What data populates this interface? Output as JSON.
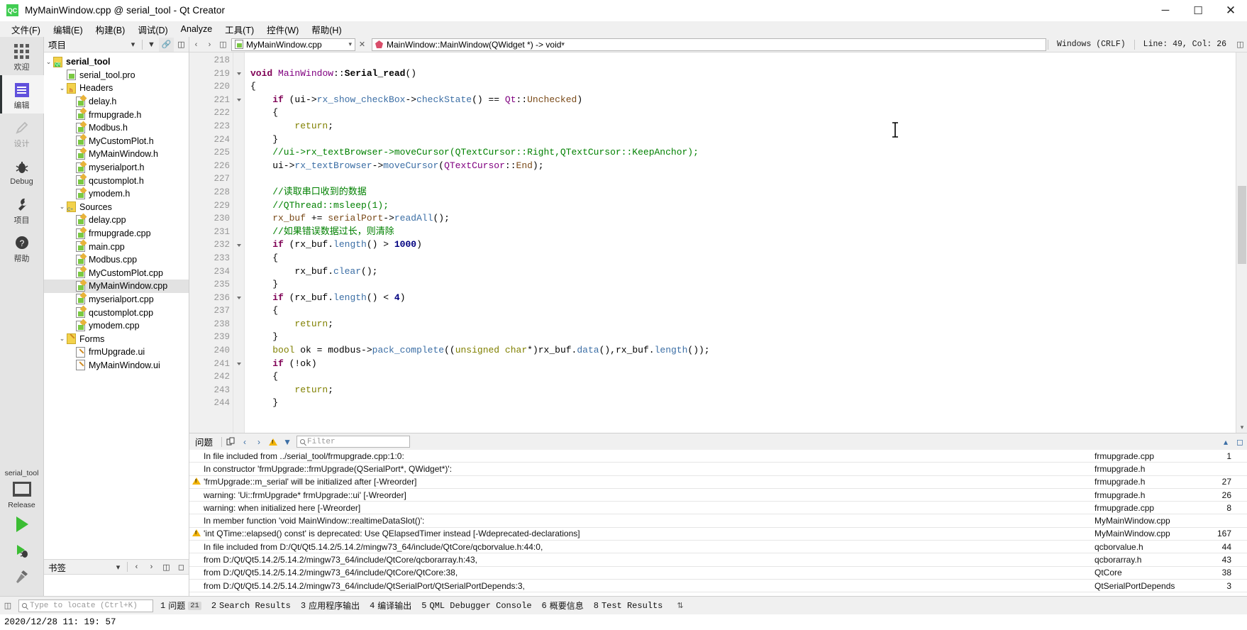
{
  "window": {
    "title": "MyMainWindow.cpp @ serial_tool - Qt Creator",
    "app_badge": "QC",
    "minimize": "─",
    "maximize": "☐",
    "close": "✕"
  },
  "menubar": [
    {
      "label": "文件(F)"
    },
    {
      "label": "编辑(E)"
    },
    {
      "label": "构建(B)"
    },
    {
      "label": "调试(D)"
    },
    {
      "label": "Analyze"
    },
    {
      "label": "工具(T)"
    },
    {
      "label": "控件(W)"
    },
    {
      "label": "帮助(H)"
    }
  ],
  "modebar": {
    "modes": [
      {
        "label": "欢迎",
        "icon": "grid-icon"
      },
      {
        "label": "编辑",
        "icon": "edit-icon"
      },
      {
        "label": "设计",
        "icon": "pencil-icon"
      },
      {
        "label": "Debug",
        "icon": "bug-icon"
      },
      {
        "label": "项目",
        "icon": "wrench-icon"
      },
      {
        "label": "帮助",
        "icon": "help-icon"
      }
    ],
    "kit_project": "serial_tool",
    "kit_build": "Release",
    "run_icon": "run-play-icon",
    "debug_icon": "debug-run-icon",
    "build_icon": "build-hammer-icon"
  },
  "sidepane": {
    "title": "项目",
    "bookmarks_title": "书签",
    "tree": [
      {
        "label": "serial_tool",
        "indent": 0,
        "icon": "qt-project-icon",
        "arrow": "⌄",
        "bold": true,
        "selected": false
      },
      {
        "label": "serial_tool.pro",
        "indent": 1,
        "icon": "pro-file-icon",
        "arrow": "",
        "bold": false,
        "selected": false
      },
      {
        "label": "Headers",
        "indent": 1,
        "icon": "headers-folder-icon",
        "arrow": "⌄",
        "bold": false,
        "selected": false
      },
      {
        "label": "delay.h",
        "indent": 2,
        "icon": "header-file-icon",
        "arrow": "",
        "bold": false,
        "selected": false
      },
      {
        "label": "frmupgrade.h",
        "indent": 2,
        "icon": "header-file-icon",
        "arrow": "",
        "bold": false,
        "selected": false
      },
      {
        "label": "Modbus.h",
        "indent": 2,
        "icon": "header-file-icon",
        "arrow": "",
        "bold": false,
        "selected": false
      },
      {
        "label": "MyCustomPlot.h",
        "indent": 2,
        "icon": "header-file-icon",
        "arrow": "",
        "bold": false,
        "selected": false
      },
      {
        "label": "MyMainWindow.h",
        "indent": 2,
        "icon": "header-file-icon",
        "arrow": "",
        "bold": false,
        "selected": false
      },
      {
        "label": "myserialport.h",
        "indent": 2,
        "icon": "header-file-icon",
        "arrow": "",
        "bold": false,
        "selected": false
      },
      {
        "label": "qcustomplot.h",
        "indent": 2,
        "icon": "header-file-icon",
        "arrow": "",
        "bold": false,
        "selected": false
      },
      {
        "label": "ymodem.h",
        "indent": 2,
        "icon": "header-file-icon",
        "arrow": "",
        "bold": false,
        "selected": false
      },
      {
        "label": "Sources",
        "indent": 1,
        "icon": "sources-folder-icon",
        "arrow": "⌄",
        "bold": false,
        "selected": false
      },
      {
        "label": "delay.cpp",
        "indent": 2,
        "icon": "cpp-file-icon",
        "arrow": "",
        "bold": false,
        "selected": false
      },
      {
        "label": "frmupgrade.cpp",
        "indent": 2,
        "icon": "cpp-file-icon",
        "arrow": "",
        "bold": false,
        "selected": false
      },
      {
        "label": "main.cpp",
        "indent": 2,
        "icon": "cpp-file-icon",
        "arrow": "",
        "bold": false,
        "selected": false
      },
      {
        "label": "Modbus.cpp",
        "indent": 2,
        "icon": "cpp-file-icon",
        "arrow": "",
        "bold": false,
        "selected": false
      },
      {
        "label": "MyCustomPlot.cpp",
        "indent": 2,
        "icon": "cpp-file-icon",
        "arrow": "",
        "bold": false,
        "selected": false
      },
      {
        "label": "MyMainWindow.cpp",
        "indent": 2,
        "icon": "cpp-file-icon",
        "arrow": "",
        "bold": false,
        "selected": true
      },
      {
        "label": "myserialport.cpp",
        "indent": 2,
        "icon": "cpp-file-icon",
        "arrow": "",
        "bold": false,
        "selected": false
      },
      {
        "label": "qcustomplot.cpp",
        "indent": 2,
        "icon": "cpp-file-icon",
        "arrow": "",
        "bold": false,
        "selected": false
      },
      {
        "label": "ymodem.cpp",
        "indent": 2,
        "icon": "cpp-file-icon",
        "arrow": "",
        "bold": false,
        "selected": false
      },
      {
        "label": "Forms",
        "indent": 1,
        "icon": "forms-folder-icon",
        "arrow": "⌄",
        "bold": false,
        "selected": false
      },
      {
        "label": "frmUpgrade.ui",
        "indent": 2,
        "icon": "ui-file-icon",
        "arrow": "",
        "bold": false,
        "selected": false
      },
      {
        "label": "MyMainWindow.ui",
        "indent": 2,
        "icon": "ui-file-icon",
        "arrow": "",
        "bold": false,
        "selected": false
      }
    ]
  },
  "editor": {
    "file_combo": "MyMainWindow.cpp",
    "symbol_combo": "MainWindow::MainWindow(QWidget *) -> void",
    "line_ending": "Windows (CRLF)",
    "cursor_position": "Line: 49, Col: 26",
    "first_line": 218,
    "lines": [
      {
        "n": 218,
        "fold": false,
        "tokens": []
      },
      {
        "n": 219,
        "fold": true,
        "tokens": [
          {
            "t": "void",
            "c": "k"
          },
          {
            "t": " ",
            "c": "plain"
          },
          {
            "t": "MainWindow",
            "c": "cls"
          },
          {
            "t": "::",
            "c": "plain"
          },
          {
            "t": "Serial_read",
            "c": "fn"
          },
          {
            "t": "()",
            "c": "plain"
          }
        ]
      },
      {
        "n": 220,
        "fold": false,
        "tokens": [
          {
            "t": "{",
            "c": "plain"
          }
        ]
      },
      {
        "n": 221,
        "fold": true,
        "tokens": [
          {
            "t": "    ",
            "c": "plain"
          },
          {
            "t": "if",
            "c": "k"
          },
          {
            "t": " (ui->",
            "c": "plain"
          },
          {
            "t": "rx_show_checkBox",
            "c": "call"
          },
          {
            "t": "->",
            "c": "plain"
          },
          {
            "t": "checkState",
            "c": "call"
          },
          {
            "t": "() == ",
            "c": "plain"
          },
          {
            "t": "Qt",
            "c": "cls"
          },
          {
            "t": "::",
            "c": "plain"
          },
          {
            "t": "Unchecked",
            "c": "var"
          },
          {
            "t": ")",
            "c": "plain"
          }
        ]
      },
      {
        "n": 222,
        "fold": false,
        "tokens": [
          {
            "t": "    {",
            "c": "plain"
          }
        ]
      },
      {
        "n": 223,
        "fold": false,
        "tokens": [
          {
            "t": "        ",
            "c": "plain"
          },
          {
            "t": "return",
            "c": "kw2"
          },
          {
            "t": ";",
            "c": "plain"
          }
        ]
      },
      {
        "n": 224,
        "fold": false,
        "tokens": [
          {
            "t": "    }",
            "c": "plain"
          }
        ]
      },
      {
        "n": 225,
        "fold": false,
        "tokens": [
          {
            "t": "    //ui->rx_textBrowser->moveCursor(QTextCursor::Right,QTextCursor::KeepAnchor);",
            "c": "cmt"
          }
        ]
      },
      {
        "n": 226,
        "fold": false,
        "tokens": [
          {
            "t": "    ui->",
            "c": "plain"
          },
          {
            "t": "rx_textBrowser",
            "c": "call"
          },
          {
            "t": "->",
            "c": "plain"
          },
          {
            "t": "moveCursor",
            "c": "call"
          },
          {
            "t": "(",
            "c": "plain"
          },
          {
            "t": "QTextCursor",
            "c": "cls"
          },
          {
            "t": "::",
            "c": "plain"
          },
          {
            "t": "End",
            "c": "var"
          },
          {
            "t": ");",
            "c": "plain"
          }
        ]
      },
      {
        "n": 227,
        "fold": false,
        "tokens": []
      },
      {
        "n": 228,
        "fold": false,
        "tokens": [
          {
            "t": "    //读取串口收到的数据",
            "c": "cmt"
          }
        ]
      },
      {
        "n": 229,
        "fold": false,
        "tokens": [
          {
            "t": "    //QThread::msleep(1);",
            "c": "cmt"
          }
        ]
      },
      {
        "n": 230,
        "fold": false,
        "tokens": [
          {
            "t": "    ",
            "c": "plain"
          },
          {
            "t": "rx_buf",
            "c": "var"
          },
          {
            "t": " += ",
            "c": "plain"
          },
          {
            "t": "serialPort",
            "c": "var"
          },
          {
            "t": "->",
            "c": "plain"
          },
          {
            "t": "readAll",
            "c": "call"
          },
          {
            "t": "();",
            "c": "plain"
          }
        ]
      },
      {
        "n": 231,
        "fold": false,
        "tokens": [
          {
            "t": "    //如果错误数据过长，则清除",
            "c": "cmt"
          }
        ]
      },
      {
        "n": 232,
        "fold": true,
        "tokens": [
          {
            "t": "    ",
            "c": "plain"
          },
          {
            "t": "if",
            "c": "k"
          },
          {
            "t": " (rx_buf.",
            "c": "plain"
          },
          {
            "t": "length",
            "c": "call"
          },
          {
            "t": "() > ",
            "c": "plain"
          },
          {
            "t": "1000",
            "c": "num"
          },
          {
            "t": ")",
            "c": "plain"
          }
        ]
      },
      {
        "n": 233,
        "fold": false,
        "tokens": [
          {
            "t": "    {",
            "c": "plain"
          }
        ]
      },
      {
        "n": 234,
        "fold": false,
        "tokens": [
          {
            "t": "        rx_buf.",
            "c": "plain"
          },
          {
            "t": "clear",
            "c": "call"
          },
          {
            "t": "();",
            "c": "plain"
          }
        ]
      },
      {
        "n": 235,
        "fold": false,
        "tokens": [
          {
            "t": "    }",
            "c": "plain"
          }
        ]
      },
      {
        "n": 236,
        "fold": true,
        "tokens": [
          {
            "t": "    ",
            "c": "plain"
          },
          {
            "t": "if",
            "c": "k"
          },
          {
            "t": " (rx_buf.",
            "c": "plain"
          },
          {
            "t": "length",
            "c": "call"
          },
          {
            "t": "() < ",
            "c": "plain"
          },
          {
            "t": "4",
            "c": "num"
          },
          {
            "t": ")",
            "c": "plain"
          }
        ]
      },
      {
        "n": 237,
        "fold": false,
        "tokens": [
          {
            "t": "    {",
            "c": "plain"
          }
        ]
      },
      {
        "n": 238,
        "fold": false,
        "tokens": [
          {
            "t": "        ",
            "c": "plain"
          },
          {
            "t": "return",
            "c": "kw2"
          },
          {
            "t": ";",
            "c": "plain"
          }
        ]
      },
      {
        "n": 239,
        "fold": false,
        "tokens": [
          {
            "t": "    }",
            "c": "plain"
          }
        ]
      },
      {
        "n": 240,
        "fold": false,
        "tokens": [
          {
            "t": "    ",
            "c": "plain"
          },
          {
            "t": "bool",
            "c": "kw2"
          },
          {
            "t": " ok = modbus->",
            "c": "plain"
          },
          {
            "t": "pack_complete",
            "c": "call"
          },
          {
            "t": "((",
            "c": "plain"
          },
          {
            "t": "unsigned",
            "c": "kw2"
          },
          {
            "t": " ",
            "c": "plain"
          },
          {
            "t": "char",
            "c": "kw2"
          },
          {
            "t": "*)rx_buf.",
            "c": "plain"
          },
          {
            "t": "data",
            "c": "call"
          },
          {
            "t": "(),rx_buf.",
            "c": "plain"
          },
          {
            "t": "length",
            "c": "call"
          },
          {
            "t": "());",
            "c": "plain"
          }
        ]
      },
      {
        "n": 241,
        "fold": true,
        "tokens": [
          {
            "t": "    ",
            "c": "plain"
          },
          {
            "t": "if",
            "c": "k"
          },
          {
            "t": " (!ok)",
            "c": "plain"
          }
        ]
      },
      {
        "n": 242,
        "fold": false,
        "tokens": [
          {
            "t": "    {",
            "c": "plain"
          }
        ]
      },
      {
        "n": 243,
        "fold": false,
        "tokens": [
          {
            "t": "        ",
            "c": "plain"
          },
          {
            "t": "return",
            "c": "kw2"
          },
          {
            "t": ";",
            "c": "plain"
          }
        ]
      },
      {
        "n": 244,
        "fold": false,
        "tokens": [
          {
            "t": "    }",
            "c": "plain"
          }
        ]
      }
    ]
  },
  "issues": {
    "title": "问题",
    "filter_placeholder": "Filter",
    "rows": [
      {
        "warn": false,
        "text": "In file included from ../serial_tool/frmupgrade.cpp:1:0:",
        "file": "frmupgrade.cpp",
        "line": "1"
      },
      {
        "warn": false,
        "text": "In constructor 'frmUpgrade::frmUpgrade(QSerialPort*, QWidget*)':",
        "file": "frmupgrade.h",
        "line": ""
      },
      {
        "warn": true,
        "text": "'frmUpgrade::m_serial' will be initialized after [-Wreorder]",
        "file": "frmupgrade.h",
        "line": "27"
      },
      {
        "warn": false,
        "text": "warning:   'Ui::frmUpgrade* frmUpgrade::ui' [-Wreorder]",
        "file": "frmupgrade.h",
        "line": "26"
      },
      {
        "warn": false,
        "text": "warning:   when initialized here [-Wreorder]",
        "file": "frmupgrade.cpp",
        "line": "8"
      },
      {
        "warn": false,
        "text": "In member function 'void MainWindow::realtimeDataSlot()':",
        "file": "MyMainWindow.cpp",
        "line": ""
      },
      {
        "warn": true,
        "text": "'int QTime::elapsed() const' is deprecated: Use QElapsedTimer instead [-Wdeprecated-declarations]",
        "file": "MyMainWindow.cpp",
        "line": "167"
      },
      {
        "warn": false,
        "text": "In file included from D:/Qt/Qt5.14.2/5.14.2/mingw73_64/include/QtCore/qcborvalue.h:44:0,",
        "file": "qcborvalue.h",
        "line": "44"
      },
      {
        "warn": false,
        "text": "from D:/Qt/Qt5.14.2/5.14.2/mingw73_64/include/QtCore/qcborarray.h:43,",
        "file": "qcborarray.h",
        "line": "43"
      },
      {
        "warn": false,
        "text": "from D:/Qt/Qt5.14.2/5.14.2/mingw73_64/include/QtCore/QtCore:38,",
        "file": "QtCore",
        "line": "38"
      },
      {
        "warn": false,
        "text": "from D:/Qt/Qt5.14.2/5.14.2/mingw73_64/include/QtSerialPort/QtSerialPortDepends:3,",
        "file": "QtSerialPortDepends",
        "line": "3"
      }
    ]
  },
  "statusbar": {
    "locator_placeholder": "Type to locate (Ctrl+K)",
    "tabs": [
      {
        "num": "1",
        "label": "问题",
        "badge": "21"
      },
      {
        "num": "2",
        "label": "Search Results",
        "badge": ""
      },
      {
        "num": "3",
        "label": "应用程序输出",
        "badge": ""
      },
      {
        "num": "4",
        "label": "编译输出",
        "badge": ""
      },
      {
        "num": "5",
        "label": "QML Debugger Console",
        "badge": ""
      },
      {
        "num": "6",
        "label": "概要信息",
        "badge": ""
      },
      {
        "num": "8",
        "label": "Test Results",
        "badge": ""
      }
    ]
  },
  "taskbar": {
    "clock": "2020/12/28  11: 19: 57"
  },
  "colors": {
    "accent_green": "#41cd52",
    "selection": "#e2e2e2",
    "warning": "#f2b40a",
    "comment": "#008000",
    "keyword": "#7f0055"
  }
}
